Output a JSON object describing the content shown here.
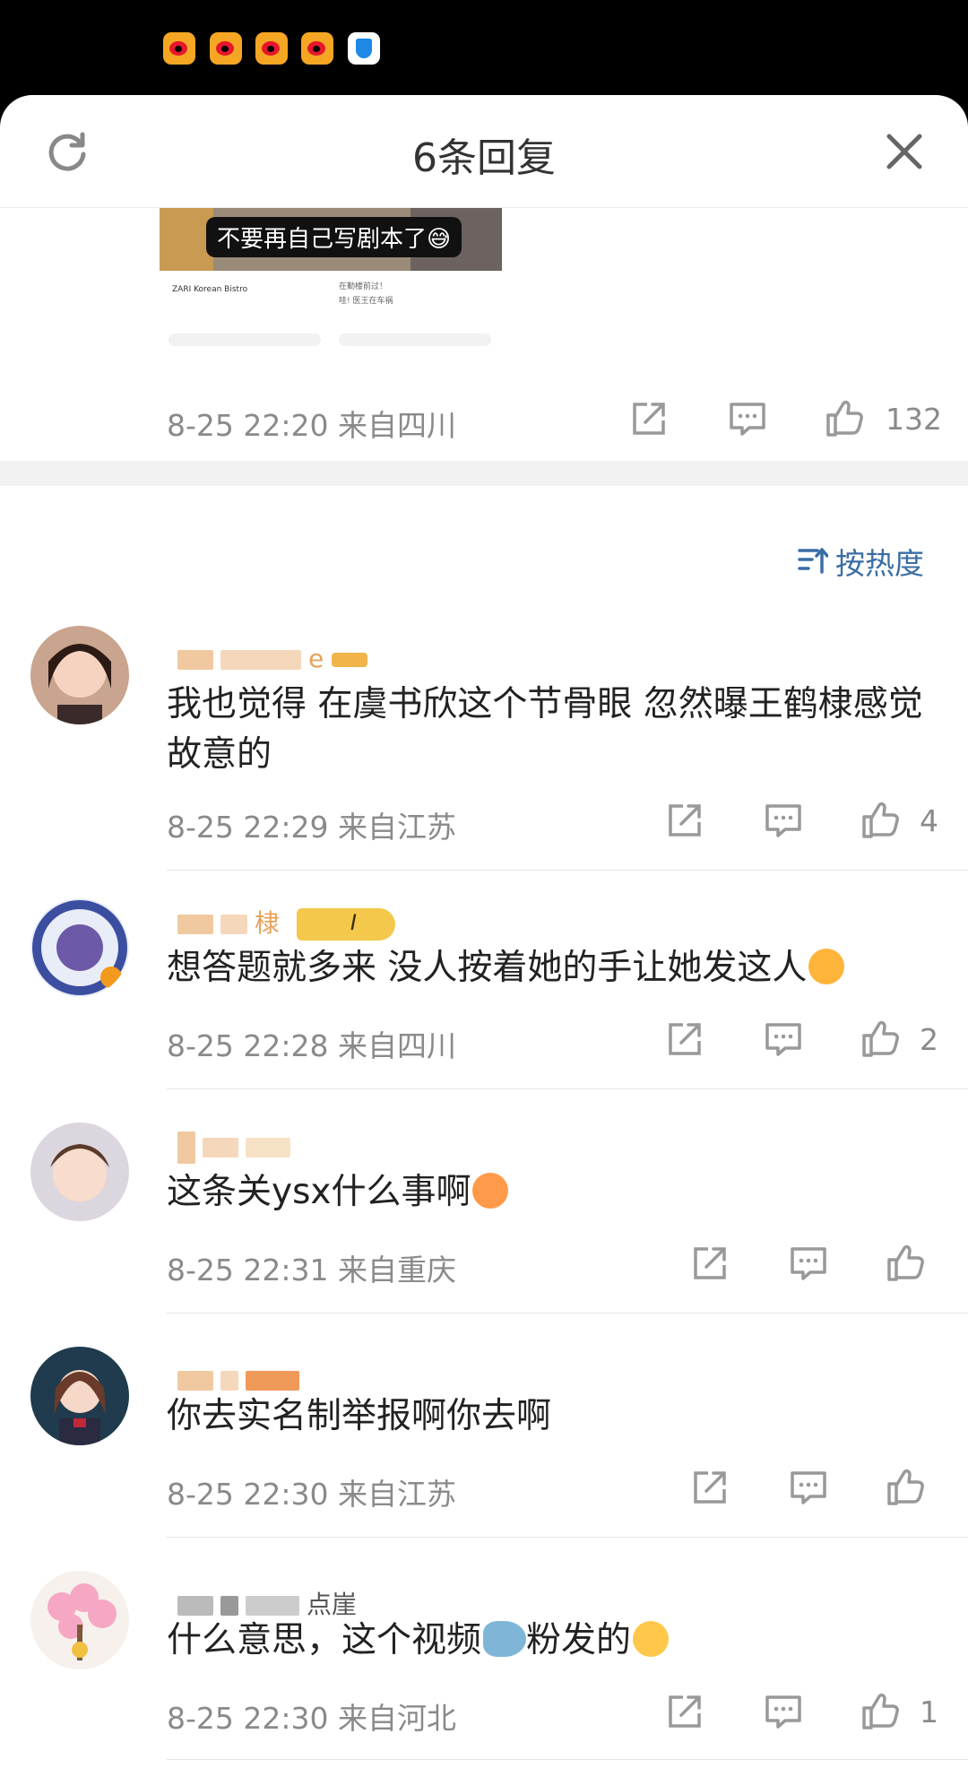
{
  "status_bar": {
    "icons": [
      "weibo-icon",
      "weibo-icon",
      "weibo-icon",
      "weibo-icon",
      "shield-icon"
    ]
  },
  "header": {
    "title": "6条回复"
  },
  "quoted_post": {
    "image_caption": "不要再自己写剧本了😅",
    "image_small_texts": [
      "ZARI Korean Bistro",
      "在勤楼前过！",
      "哇! 医王在车祸"
    ],
    "time": "8-25 22:20",
    "location": "来自四川",
    "likes": "132"
  },
  "sort": {
    "label": "按热度"
  },
  "comments": [
    {
      "username_visible": "e",
      "text": "我也觉得 在虞书欣这个节骨眼 忽然曝王鹤棣感觉故意的",
      "time": "8-25 22:29",
      "location": "来自江苏",
      "likes": "4"
    },
    {
      "username_visible": "棣",
      "badge_text": "I",
      "text": "想答题就多来 没人按着她的手让她发这人",
      "time": "8-25 22:28",
      "location": "来自四川",
      "likes": "2"
    },
    {
      "username_visible": "",
      "text": "这条关ysx什么事啊",
      "time": "8-25 22:31",
      "location": "来自重庆",
      "likes": ""
    },
    {
      "username_visible": "",
      "text": "你去实名制举报啊你去啊",
      "time": "8-25 22:30",
      "location": "来自江苏",
      "likes": ""
    },
    {
      "username_visible": "点崖",
      "text_before": "什么意思，这个视频",
      "text_after": "粉发的",
      "time": "8-25 22:30",
      "location": "来自河北",
      "likes": "1"
    }
  ],
  "colors": {
    "accent": "#3a6ea5",
    "username": "#e8a25a",
    "meta_gray": "#8a8a8a"
  }
}
